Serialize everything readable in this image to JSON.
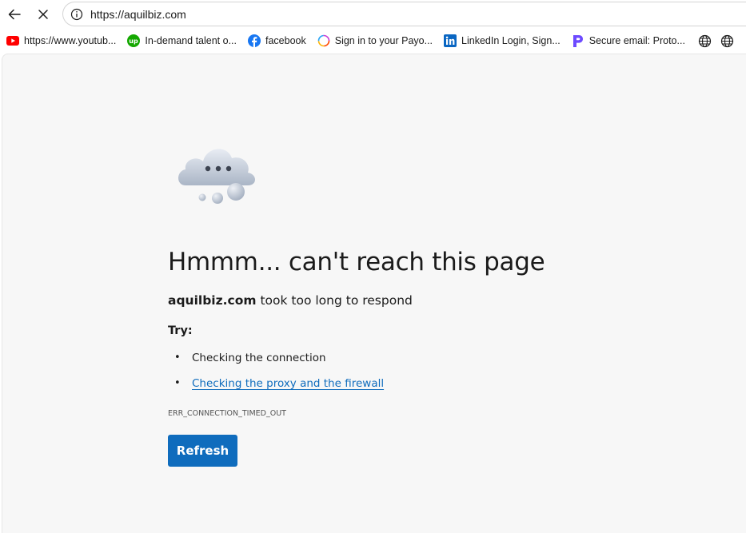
{
  "browser": {
    "url": "https://aquilbiz.com",
    "nav_icons": [
      "back-arrow-icon",
      "stop-icon",
      "info-icon"
    ]
  },
  "bookmarks": [
    {
      "label": "https://www.youtub...",
      "icon": "youtube-icon",
      "color": "#ff0000"
    },
    {
      "label": "In-demand talent o...",
      "icon": "upwork-icon",
      "color": "#14a800"
    },
    {
      "label": "facebook",
      "icon": "facebook-icon",
      "color": "#1877f2"
    },
    {
      "label": "Sign in to your Payo...",
      "icon": "payoneer-icon",
      "color": "#ff4800"
    },
    {
      "label": "LinkedIn Login, Sign...",
      "icon": "linkedin-icon",
      "color": "#0a66c2"
    },
    {
      "label": "Secure email: Proto...",
      "icon": "proton-icon",
      "color": "#6d4aff"
    }
  ],
  "error_page": {
    "headline": "Hmmm... can't reach this page",
    "domain": "aquilbiz.com",
    "subline_rest": " took too long to respond",
    "try_label": "Try:",
    "tips": [
      {
        "label": "Checking the connection",
        "link": false
      },
      {
        "label": "Checking the proxy and the firewall",
        "link": true
      }
    ],
    "error_code": "ERR_CONNECTION_TIMED_OUT",
    "refresh_label": "Refresh",
    "accent_color": "#0f6cbd"
  }
}
